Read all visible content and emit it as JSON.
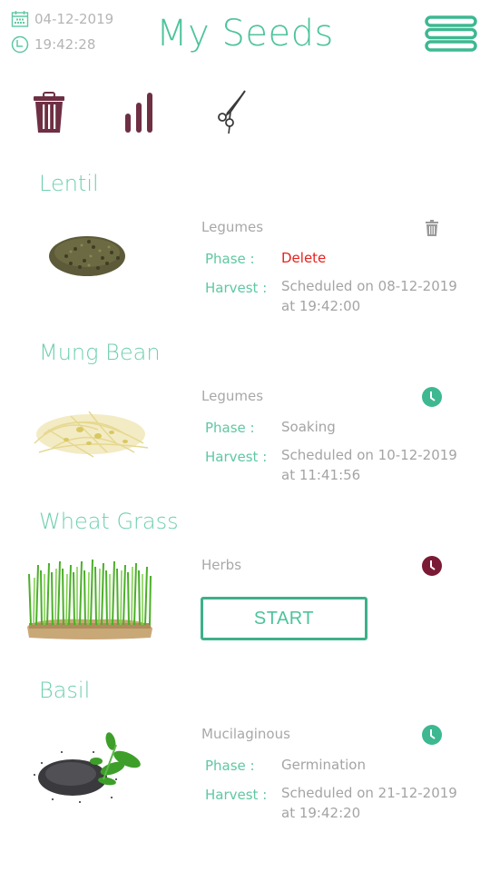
{
  "header": {
    "date": "04-12-2019",
    "time": "19:42:28",
    "title": "My Seeds",
    "date_icon": "calendar-icon",
    "time_icon": "clock-icon",
    "menu_icon": "hamburger-menu-icon"
  },
  "toolbar": {
    "items": [
      {
        "name": "trash",
        "icon": "trash-icon"
      },
      {
        "name": "stats",
        "icon": "bar-chart-icon"
      },
      {
        "name": "harvest",
        "icon": "scissors-icon"
      }
    ]
  },
  "colors": {
    "accent": "#4cc39b",
    "toolbar_icon": "#6e2f43",
    "delete_red": "#e8211d",
    "clock_green": "#3db890",
    "clock_maroon": "#7b1a35"
  },
  "labels": {
    "phase": "Phase :",
    "harvest": "Harvest :"
  },
  "seeds": [
    {
      "name": "Lentil",
      "category": "Legumes",
      "status_icon": "trash-icon",
      "phase": "Delete",
      "harvest_line1": "Scheduled on 08-12-2019",
      "harvest_line2": "at 19:42:00"
    },
    {
      "name": "Mung Bean",
      "category": "Legumes",
      "status_icon": "clock-icon",
      "phase": "Soaking",
      "harvest_line1": "Scheduled on 10-12-2019",
      "harvest_line2": "at 11:41:56"
    },
    {
      "name": "Wheat Grass",
      "category": "Herbs",
      "status_icon": "clock-icon",
      "start_label": "START"
    },
    {
      "name": "Basil",
      "category": "Mucilaginous",
      "status_icon": "clock-icon",
      "phase": "Germination",
      "harvest_line1": "Scheduled on 21-12-2019",
      "harvest_line2": "at 19:42:20"
    }
  ]
}
